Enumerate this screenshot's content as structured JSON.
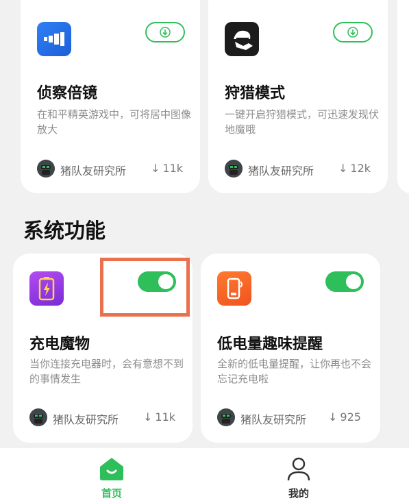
{
  "colors": {
    "accent": "#2fbf5a",
    "highlight": "#e9714e",
    "background": "#f1f1f1"
  },
  "top_cards": [
    {
      "title": "侦察倍镜",
      "desc": "在和平精英游戏中，可将居中图像放大",
      "author": "猪队友研究所",
      "downloads": "11k",
      "icon": "scope-icon",
      "action": "download-icon"
    },
    {
      "title": "狩猎模式",
      "desc": "一键开启狩猎模式，可迅速发现伏地魔哦",
      "author": "猪队友研究所",
      "downloads": "12k",
      "icon": "hunter-icon",
      "action": "download-icon"
    }
  ],
  "section": {
    "title": "系统功能"
  },
  "system_cards": [
    {
      "title": "充电魔物",
      "desc": "当你连接充电器时，会有意想不到的事情发生",
      "author": "猪队友研究所",
      "downloads": "11k",
      "icon": "battery-charging-icon",
      "toggle_on": true
    },
    {
      "title": "低电量趣味提醒",
      "desc": "全新的低电量提醒，让你再也不会忘记充电啦",
      "author": "猪队友研究所",
      "downloads": "925",
      "icon": "low-battery-phone-icon",
      "toggle_on": true
    }
  ],
  "tabs": [
    {
      "label": "首页",
      "icon": "home-icon",
      "active": true
    },
    {
      "label": "我的",
      "icon": "profile-icon",
      "active": false
    }
  ]
}
